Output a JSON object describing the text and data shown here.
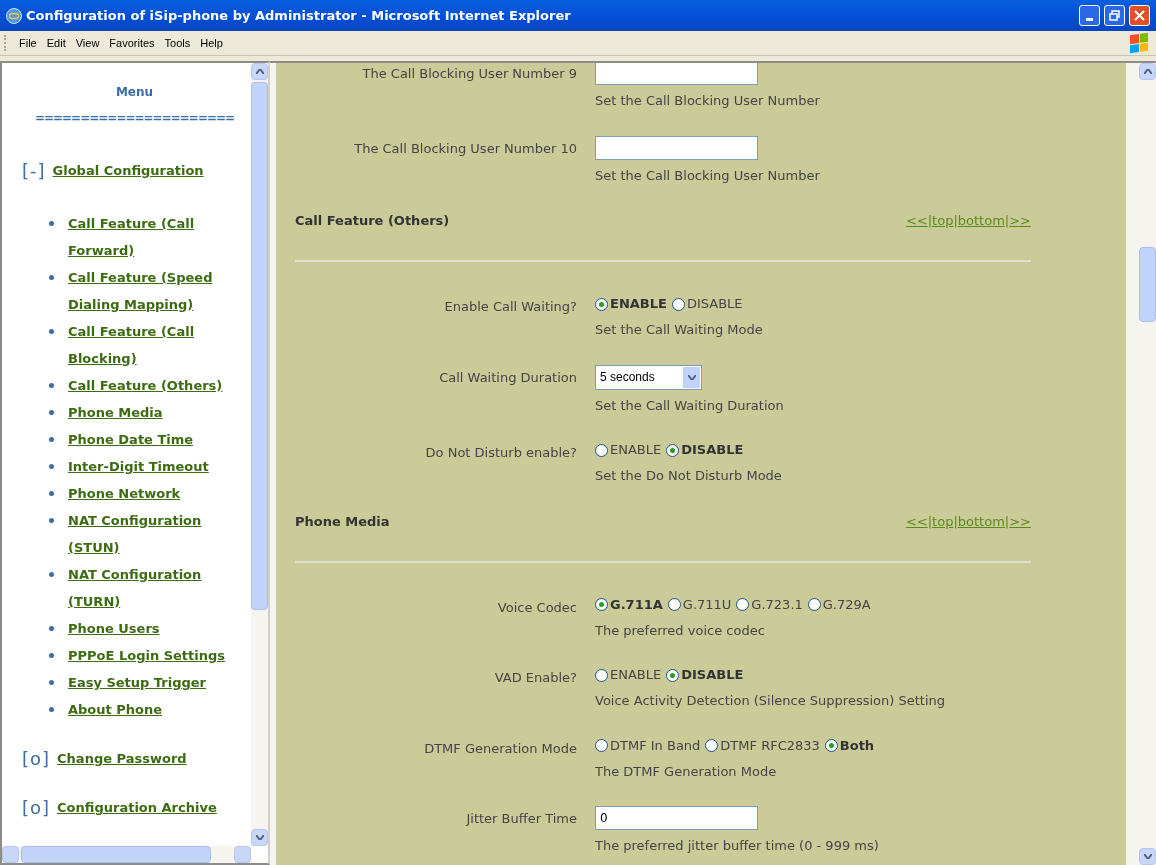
{
  "window": {
    "title": "Configuration of iSip-phone by Administrator - Microsoft Internet Explorer"
  },
  "menu_bar": [
    "File",
    "Edit",
    "View",
    "Favorites",
    "Tools",
    "Help"
  ],
  "sidebar": {
    "title": "Menu",
    "rule": "======================",
    "groups": [
      {
        "marker": "[-]",
        "label": "Global Configuration",
        "children": [
          {
            "label": "Call Feature (Call Forward)"
          },
          {
            "label": "Call Feature (Speed Dialing Mapping)"
          },
          {
            "label": "Call Feature (Call Blocking)"
          },
          {
            "label": "Call Feature (Others)"
          },
          {
            "label": "Phone Media"
          },
          {
            "label": "Phone Date Time"
          },
          {
            "label": "Inter-Digit Timeout"
          },
          {
            "label": "Phone Network"
          },
          {
            "label": "NAT Configuration (STUN)"
          },
          {
            "label": "NAT Configuration (TURN)"
          },
          {
            "label": "Phone Users"
          },
          {
            "label": "PPPoE Login Settings"
          },
          {
            "label": "Easy Setup Trigger"
          },
          {
            "label": "About Phone"
          }
        ]
      },
      {
        "marker": "[o]",
        "label": "Change Password"
      },
      {
        "marker": "[o]",
        "label": "Configuration Archive"
      }
    ]
  },
  "content": [
    {
      "kind": "text",
      "label": "The Call Blocking User Number 9",
      "help": "Set the Call Blocking User Number"
    },
    {
      "kind": "text",
      "label": "The Call Blocking User Number 10",
      "help": "Set the Call Blocking User Number"
    },
    {
      "kind": "header",
      "title": "Call Feature (Others)",
      "nav": [
        "<<",
        "top",
        "bottom",
        ">>"
      ],
      "nav_separator": "|"
    },
    {
      "kind": "radio",
      "label": "Enable Call Waiting?",
      "options": [
        {
          "label": "ENABLE",
          "selected": true
        },
        {
          "label": "DISABLE",
          "selected": false
        }
      ],
      "help": "Set the Call Waiting Mode"
    },
    {
      "kind": "select",
      "label": "Call Waiting Duration",
      "value": "5 seconds",
      "help": "Set the Call Waiting Duration"
    },
    {
      "kind": "radio",
      "label": "Do Not Disturb enable?",
      "options": [
        {
          "label": "ENABLE",
          "selected": false
        },
        {
          "label": "DISABLE",
          "selected": true
        }
      ],
      "help": "Set the Do Not Disturb Mode"
    },
    {
      "kind": "header",
      "title": "Phone Media",
      "nav": [
        "<<",
        "top",
        "bottom",
        ">>"
      ],
      "nav_separator": "|"
    },
    {
      "kind": "radio",
      "label": "Voice Codec",
      "options": [
        {
          "label": "G.711A",
          "selected": true
        },
        {
          "label": "G.711U",
          "selected": false
        },
        {
          "label": "G.723.1",
          "selected": false
        },
        {
          "label": "G.729A",
          "selected": false
        }
      ],
      "help": "The preferred voice codec"
    },
    {
      "kind": "radio",
      "label": "VAD Enable?",
      "options": [
        {
          "label": "ENABLE",
          "selected": false
        },
        {
          "label": "DISABLE",
          "selected": true
        }
      ],
      "help": "Voice Activity Detection (Silence Suppression) Setting"
    },
    {
      "kind": "radio",
      "label": "DTMF Generation Mode",
      "options": [
        {
          "label": "DTMF In Band",
          "selected": false
        },
        {
          "label": "DTMF RFC2833",
          "selected": false
        },
        {
          "label": "Both",
          "selected": true
        }
      ],
      "help": "The DTMF Generation Mode"
    },
    {
      "kind": "text",
      "label": "Jitter Buffer Time",
      "value": "0",
      "help": "The preferred jitter buffer time (0 - 999 ms)"
    }
  ]
}
